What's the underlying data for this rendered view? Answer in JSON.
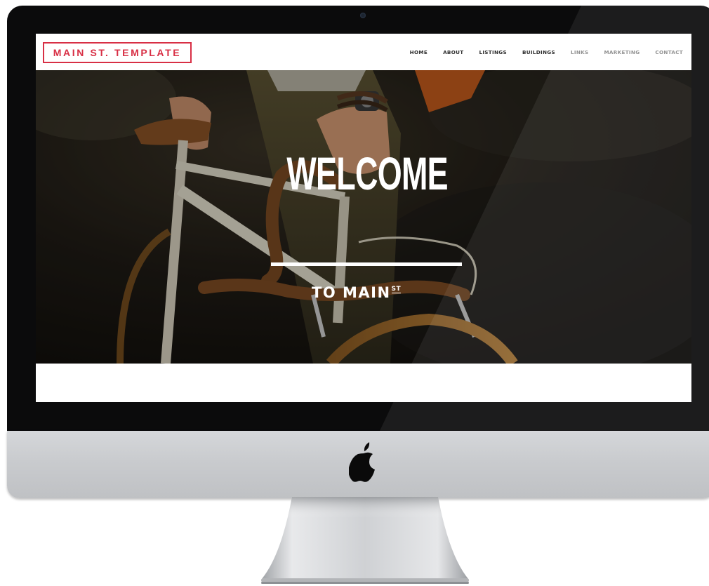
{
  "site": {
    "logo_text": "MAIN ST. TEMPLATE",
    "nav": [
      {
        "label": "HOME"
      },
      {
        "label": "ABOUT"
      },
      {
        "label": "LISTINGS"
      },
      {
        "label": "BUILDINGS"
      },
      {
        "label": "LINKS"
      },
      {
        "label": "MARKETING"
      },
      {
        "label": "CONTACT"
      }
    ]
  },
  "hero": {
    "title": "WELCOME",
    "subtitle": "TO MAIN",
    "subtitle_sup": "ST"
  },
  "colors": {
    "brand_red": "#d82f45",
    "nav_text": "#2e2e2e",
    "hero_text": "#ffffff",
    "bezel": "#0b0b0c",
    "aluminum": "#c9cbce"
  },
  "icons": {
    "device_logo": "apple-icon"
  }
}
